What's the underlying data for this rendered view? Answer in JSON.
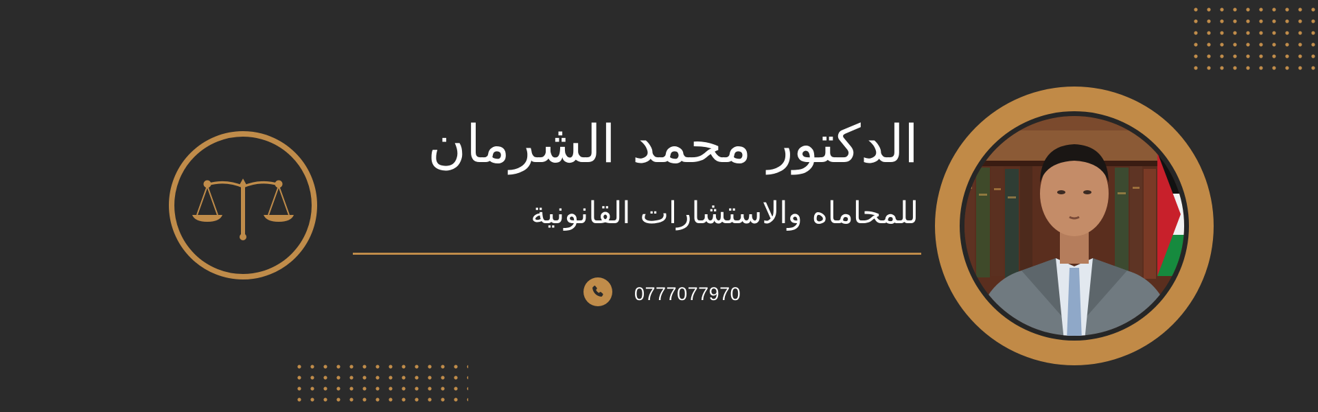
{
  "header": {
    "name": "الدكتور محمد الشرمان",
    "tagline": "للمحاماه والاستشارات القانونية"
  },
  "contact": {
    "phone_icon": "phone-icon",
    "phone": "0777077970"
  },
  "emblem": {
    "icon": "scales-of-justice-icon"
  },
  "portrait": {
    "icon": "lawyer-portrait"
  },
  "colors": {
    "background": "#2b2b2b",
    "accent": "#c08c4a",
    "text": "#ffffff"
  }
}
